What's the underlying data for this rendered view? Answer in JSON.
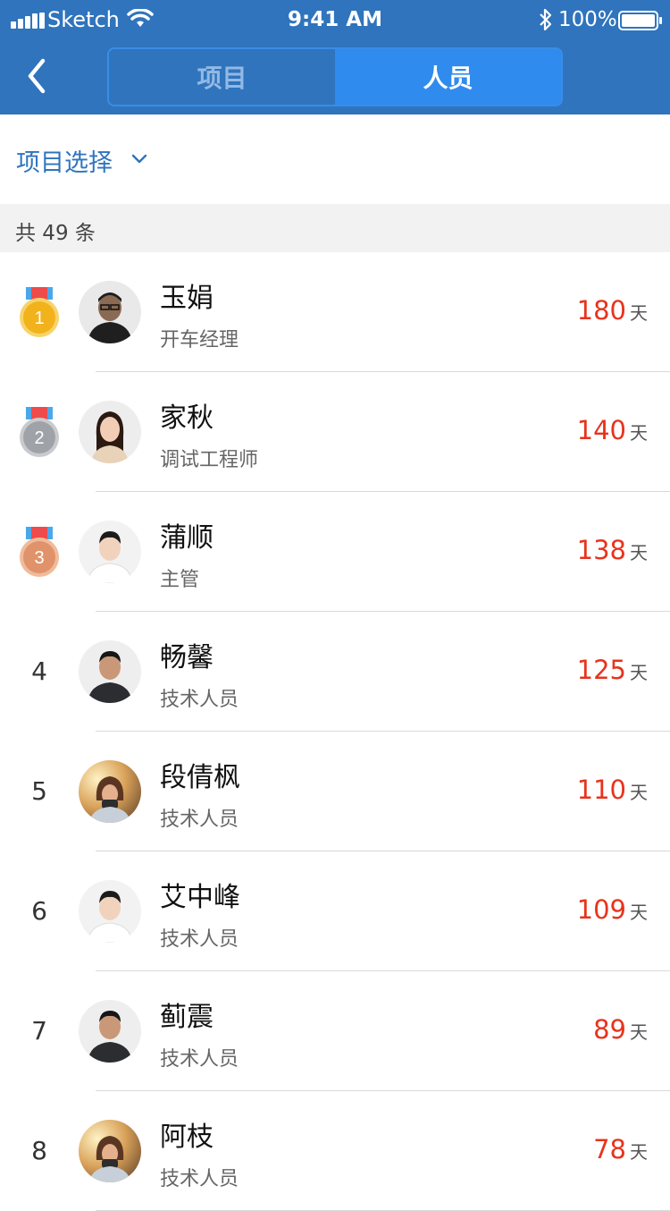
{
  "status_bar": {
    "carrier": "Sketch",
    "time": "9:41 AM",
    "battery_percent": "100%"
  },
  "tabs": {
    "projects_label": "项目",
    "people_label": "人员",
    "active": "people"
  },
  "filter": {
    "label": "项目选择"
  },
  "summary": {
    "count_text": "共 49 条"
  },
  "unit_label": "天",
  "people": [
    {
      "rank": "1",
      "name": "玉娟",
      "role": "开车经理",
      "days": "180",
      "medal": "gold",
      "avatar": "dark-man"
    },
    {
      "rank": "2",
      "name": "家秋",
      "role": "调试工程师",
      "days": "140",
      "medal": "silver",
      "avatar": "woman"
    },
    {
      "rank": "3",
      "name": "蒲顺",
      "role": "主管",
      "days": "138",
      "medal": "bronze",
      "avatar": "man-light"
    },
    {
      "rank": "4",
      "name": "畅馨",
      "role": "技术人员",
      "days": "125",
      "medal": "",
      "avatar": "man-dark-shirt"
    },
    {
      "rank": "5",
      "name": "段倩枫",
      "role": "技术人员",
      "days": "110",
      "medal": "",
      "avatar": "woman-sunset"
    },
    {
      "rank": "6",
      "name": "艾中峰",
      "role": "技术人员",
      "days": "109",
      "medal": "",
      "avatar": "man-light"
    },
    {
      "rank": "7",
      "name": "蓟震",
      "role": "技术人员",
      "days": "89",
      "medal": "",
      "avatar": "man-dark-shirt"
    },
    {
      "rank": "8",
      "name": "阿枝",
      "role": "技术人员",
      "days": "78",
      "medal": "",
      "avatar": "woman-sunset"
    }
  ],
  "colors": {
    "header": "#2f74bd",
    "segment_active": "#2f8bee",
    "accent_text": "#2f74bd",
    "days_red": "#e8331c",
    "gold": "#f2b21c",
    "silver": "#9fa3a8",
    "bronze": "#e0936a"
  }
}
